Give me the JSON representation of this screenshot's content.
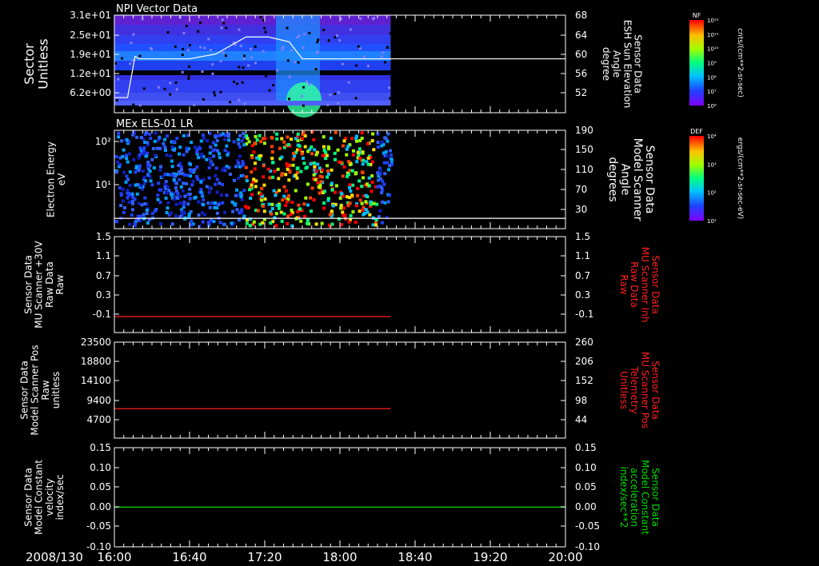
{
  "date_label": "2008/130",
  "time_ticks": [
    "16:00",
    "16:40",
    "17:20",
    "18:00",
    "18:40",
    "19:20",
    "20:00"
  ],
  "chart_data": [
    {
      "type": "heatmap",
      "title": "NPI Vector Data",
      "ylabel": "Sector\nUnitless",
      "y_ticks": [
        "3.1e+01",
        "2.5e+01",
        "1.9e+01",
        "1.2e+01",
        "6.2e+00"
      ],
      "right_ylabel": "Sensor Data\nESH Sun Elevation\nAngle\ndegree",
      "right_ticks": [
        "68",
        "64",
        "60",
        "56",
        "52"
      ],
      "overlay_line": {
        "name": "ESH Sun Elevation Angle",
        "x": [
          "16:00",
          "16:07",
          "16:11",
          "16:13",
          "16:40",
          "16:54",
          "17:10",
          "17:22",
          "17:33",
          "17:40",
          "18:27",
          "20:00"
        ],
        "y": [
          51,
          51,
          59.5,
          59,
          59,
          60,
          63.5,
          63.5,
          62.5,
          59,
          59,
          59
        ]
      },
      "colorbar": {
        "label": "NF",
        "unit": "cnts/(cm**2-sr-sec)",
        "ticks": [
          "10¹²",
          "10¹¹",
          "10¹⁰",
          "10⁹",
          "10⁸",
          "10⁷",
          "10⁶"
        ]
      }
    },
    {
      "type": "heatmap",
      "title": "MEx ELS-01 LR",
      "ylabel": "Electron Energy\neV",
      "y_ticks": [
        "10²",
        "10¹"
      ],
      "right_ylabel": "Sensor Data\nModel Scanner\nAngle\ndegrees",
      "right_ticks": [
        "190",
        "150",
        "110",
        "70",
        "30"
      ],
      "overlay_line": {
        "name": "Model Scanner Angle",
        "x": [
          "16:00",
          "20:00"
        ],
        "y": [
          12,
          12
        ]
      },
      "colorbar": {
        "label": "DEF",
        "unit": "ergs/(cm**2-sr-sec-eV)",
        "ticks": [
          "10⁴",
          "10³",
          "10²",
          "10¹"
        ]
      }
    },
    {
      "type": "line",
      "ylabel": "Sensor Data\nMU Scanner +30V\nRaw Data\nRaw",
      "y_ticks": [
        "1.5",
        "1.1",
        "0.7",
        "0.3",
        "-0.1"
      ],
      "ylim": [
        -0.3,
        1.5
      ],
      "right_ylabel": "Sensor Data\nMU Scanner Inh\nRaw Data\nRaw",
      "right_ticks": [
        "1.5",
        "1.1",
        "0.7",
        "0.3",
        "-0.1"
      ],
      "series": [
        {
          "x": [
            "16:00",
            "18:27"
          ],
          "y": [
            0,
            0
          ],
          "color": "#ff2020"
        }
      ]
    },
    {
      "type": "line",
      "ylabel": "Sensor Data\nModel Scanner Pos\nRaw\nunitless",
      "y_ticks": [
        "23500",
        "18800",
        "14100",
        "9400",
        "4700"
      ],
      "ylim": [
        0,
        23500
      ],
      "right_ylabel": "Sensor Data\nMU Scanner Pos\nTelemetry\nUnitless",
      "right_ticks": [
        "260",
        "206",
        "152",
        "98",
        "44"
      ],
      "series": [
        {
          "x": [
            "16:00",
            "18:27"
          ],
          "y": [
            7200,
            7200
          ],
          "color": "#ff2020"
        }
      ]
    },
    {
      "type": "line",
      "ylabel": "Sensor Data\nModel Constant\nvelocity\nindex/sec",
      "y_ticks": [
        "0.15",
        "0.10",
        "0.05",
        "0.00",
        "-0.05",
        "-0.10"
      ],
      "ylim": [
        -0.1,
        0.15
      ],
      "right_ylabel": "Sensor Data\nModel Constant\nacceleration\nindex/sec**2",
      "right_ticks": [
        "0.15",
        "0.10",
        "0.05",
        "0.00",
        "-0.05",
        "-0.10"
      ],
      "series": [
        {
          "x": [
            "16:00",
            "20:00"
          ],
          "y": [
            0,
            0
          ],
          "color": "#00dd00"
        }
      ]
    }
  ],
  "colors": {
    "red_label": "#ff2020",
    "green_label": "#00dd00"
  }
}
